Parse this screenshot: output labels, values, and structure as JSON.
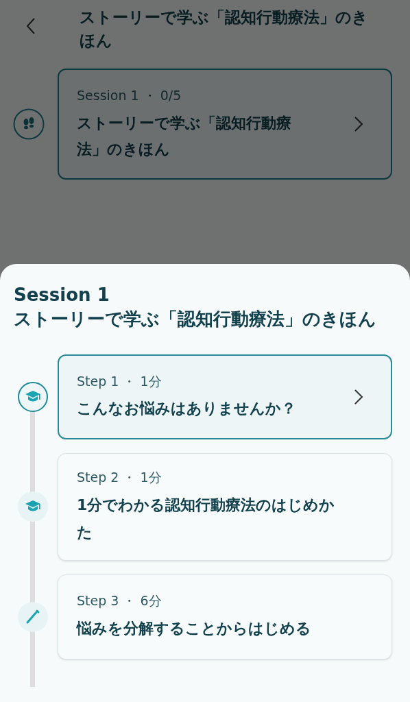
{
  "header": {
    "title": "ストーリーで学ぶ「認知行動療法」のきほん"
  },
  "session_card": {
    "meta": "Session 1 ・ 0/5",
    "title": "ストーリーで学ぶ「認知行動療法」のきほん"
  },
  "sheet": {
    "title": "Session 1",
    "subtitle": "ストーリーで学ぶ「認知行動療法」のきほん",
    "steps": [
      {
        "kind": "lesson",
        "meta": "Step 1 ・ 1分",
        "title": "こんなお悩みはありませんか？",
        "selected": true
      },
      {
        "kind": "lesson",
        "meta": "Step 2 ・ 1分",
        "title": "1分でわかる認知行動療法のはじめかた",
        "selected": false
      },
      {
        "kind": "exercise",
        "meta": "Step 3 ・ 6分",
        "title": "悩みを分解することからはじめる",
        "selected": false
      }
    ]
  }
}
